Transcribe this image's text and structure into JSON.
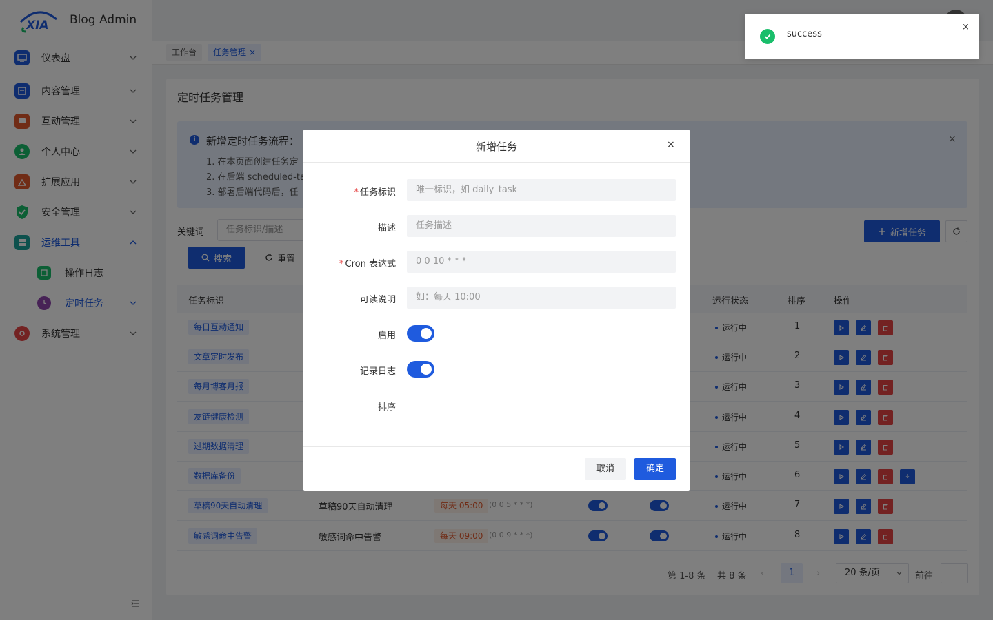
{
  "app": {
    "title": "Blog Admin",
    "logo_text": "XIA"
  },
  "sidebar": {
    "items": [
      {
        "label": "仪表盘",
        "icon": "dashboard-icon",
        "color": "#1f5bde"
      },
      {
        "label": "内容管理",
        "icon": "content-icon",
        "color": "#1f5bde"
      },
      {
        "label": "互动管理",
        "icon": "chat-icon",
        "color": "#e0582c"
      },
      {
        "label": "个人中心",
        "icon": "user-icon",
        "color": "#19be6b"
      },
      {
        "label": "扩展应用",
        "icon": "app-icon",
        "color": "#e0582c"
      },
      {
        "label": "安全管理",
        "icon": "shield-icon",
        "color": "#19be6b"
      },
      {
        "label": "运维工具",
        "icon": "ops-icon",
        "color": "#1aa39a"
      },
      {
        "label": "操作日志",
        "icon": "log-icon",
        "color": "#19be6b"
      },
      {
        "label": "定时任务",
        "icon": "clock-icon",
        "color": "#8e44ad"
      },
      {
        "label": "系统管理",
        "icon": "system-icon",
        "color": "#e64545"
      }
    ]
  },
  "tabs": [
    {
      "label": "工作台"
    },
    {
      "label": "任务管理"
    }
  ],
  "page": {
    "title": "定时任务管理",
    "alert": {
      "title": "新增定时任务流程：",
      "lines": [
        "1. 在本页面创建任务定",
        "2. 在后端 scheduled-ta",
        "3. 部署后端代码后，任"
      ]
    },
    "filter": {
      "keyword_label": "关键词",
      "keyword_placeholder": "任务标识/描述",
      "search_label": "搜索",
      "reset_label": "重置",
      "add_label": "新增任务"
    },
    "table": {
      "headers": [
        "任务标识",
        "运行状态",
        "排序",
        "操作"
      ],
      "rows": [
        {
          "id": "每日互动通知",
          "desc": "",
          "cron_label": "",
          "cron_expr": "",
          "status": "运行中",
          "sort": "1"
        },
        {
          "id": "文章定时发布",
          "desc": "",
          "cron_label": "",
          "cron_expr": "",
          "status": "运行中",
          "sort": "2"
        },
        {
          "id": "每月博客月报",
          "desc": "",
          "cron_label": "",
          "cron_expr": "",
          "status": "运行中",
          "sort": "3"
        },
        {
          "id": "友链健康检测",
          "desc": "",
          "cron_label": "",
          "cron_expr": "",
          "status": "运行中",
          "sort": "4"
        },
        {
          "id": "过期数据清理",
          "desc": "",
          "cron_label": "",
          "cron_expr": "",
          "status": "运行中",
          "sort": "5"
        },
        {
          "id": "数据库备份",
          "desc": "",
          "cron_label": "",
          "cron_expr": "",
          "status": "运行中",
          "sort": "6"
        },
        {
          "id": "草稿90天自动清理",
          "desc": "草稿90天自动清理",
          "cron_label": "每天 05:00",
          "cron_expr": "(0 0 5 * * *)",
          "status": "运行中",
          "sort": "7"
        },
        {
          "id": "敏感词命中告警",
          "desc": "敏感词命中告警",
          "cron_label": "每天 09:00",
          "cron_expr": "(0 0 9 * * *)",
          "status": "运行中",
          "sort": "8"
        }
      ]
    },
    "pager": {
      "range": "第 1-8 条",
      "total": "共 8 条",
      "current": "1",
      "page_size": "20 条/页",
      "goto": "前往"
    }
  },
  "modal": {
    "title": "新增任务",
    "fields": {
      "task_id_label": "任务标识",
      "task_id_placeholder": "唯一标识，如 daily_task",
      "desc_label": "描述",
      "desc_placeholder": "任务描述",
      "cron_label": "Cron 表达式",
      "cron_placeholder": "0 0 10 * * *",
      "readable_label": "可读说明",
      "readable_placeholder": "如：每天 10:00",
      "enabled_label": "启用",
      "log_label": "记录日志",
      "sort_label": "排序"
    },
    "cancel_label": "取消",
    "ok_label": "确定"
  },
  "toast": {
    "text": "success"
  },
  "colors": {
    "primary": "#1f5bde",
    "danger": "#e64545",
    "success": "#19be6b"
  }
}
